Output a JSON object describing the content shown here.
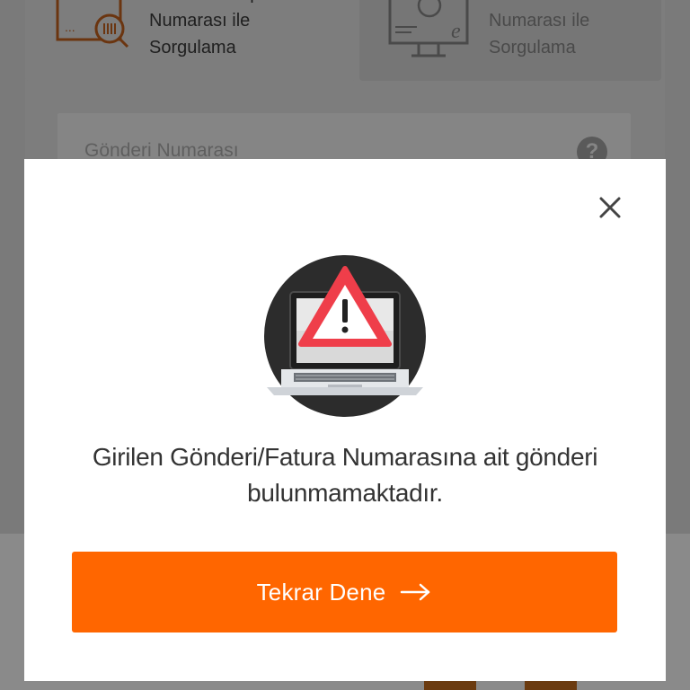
{
  "background": {
    "tabs": [
      {
        "label": "Gönderi/Takip\nNumarası ile\nSorgulama",
        "active": true
      },
      {
        "label": "Fatura\nNumarası ile\nSorgulama",
        "active": false
      }
    ],
    "search": {
      "placeholder": "Gönderi Numarası",
      "help_icon": "question-circle-icon"
    }
  },
  "modal": {
    "close_icon": "close-icon",
    "illustration": "laptop-warning-icon",
    "message": "Girilen Gönderi/Fatura Numarasına ait gönderi bulunmamaktadır.",
    "button_label": "Tekrar Dene",
    "button_icon": "arrow-right-icon"
  },
  "colors": {
    "accent": "#ff6600",
    "warning_red": "#ef3e4a",
    "text": "#333333"
  }
}
